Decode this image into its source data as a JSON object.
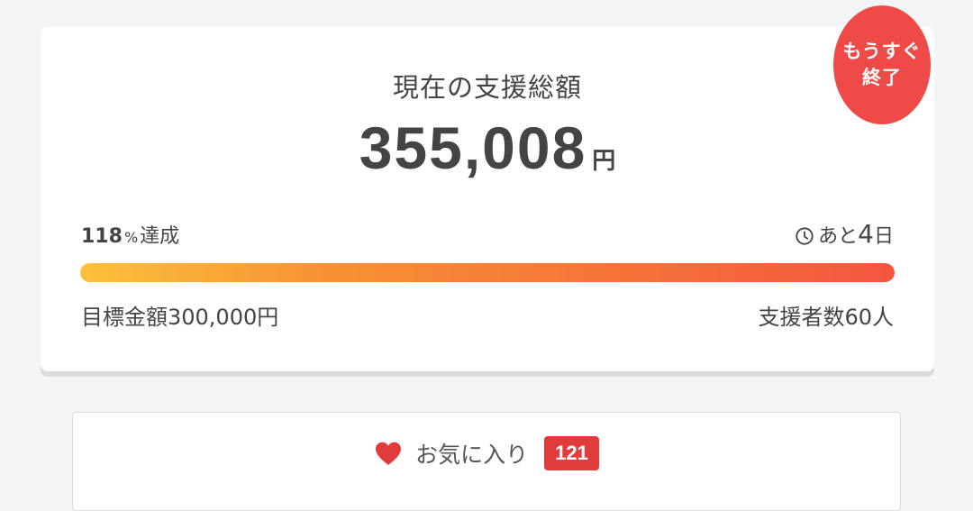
{
  "badge": {
    "line1": "もうすぐ",
    "line2": "終了"
  },
  "summary": {
    "title": "現在の支援総額",
    "amount": "355,008",
    "currency": "円"
  },
  "progress": {
    "rate_number": "118",
    "rate_percent": "%",
    "rate_suffix": "達成",
    "percent_value": 118,
    "remaining_prefix": "あと",
    "remaining_days": "4",
    "remaining_suffix": "日",
    "clock_icon": "clock-icon",
    "bar_colors": [
      "#fcc13b",
      "#f79233",
      "#f4563f"
    ]
  },
  "goal": {
    "text": "目標金額300,000円"
  },
  "backers": {
    "text": "支援者数60人"
  },
  "favorite": {
    "icon": "heart-icon",
    "label": "お気に入り",
    "count": "121",
    "heart_color": "#e13c3c"
  },
  "colors": {
    "badge": "#ef4a48",
    "count_badge": "#e13c3c",
    "text": "#444444"
  }
}
